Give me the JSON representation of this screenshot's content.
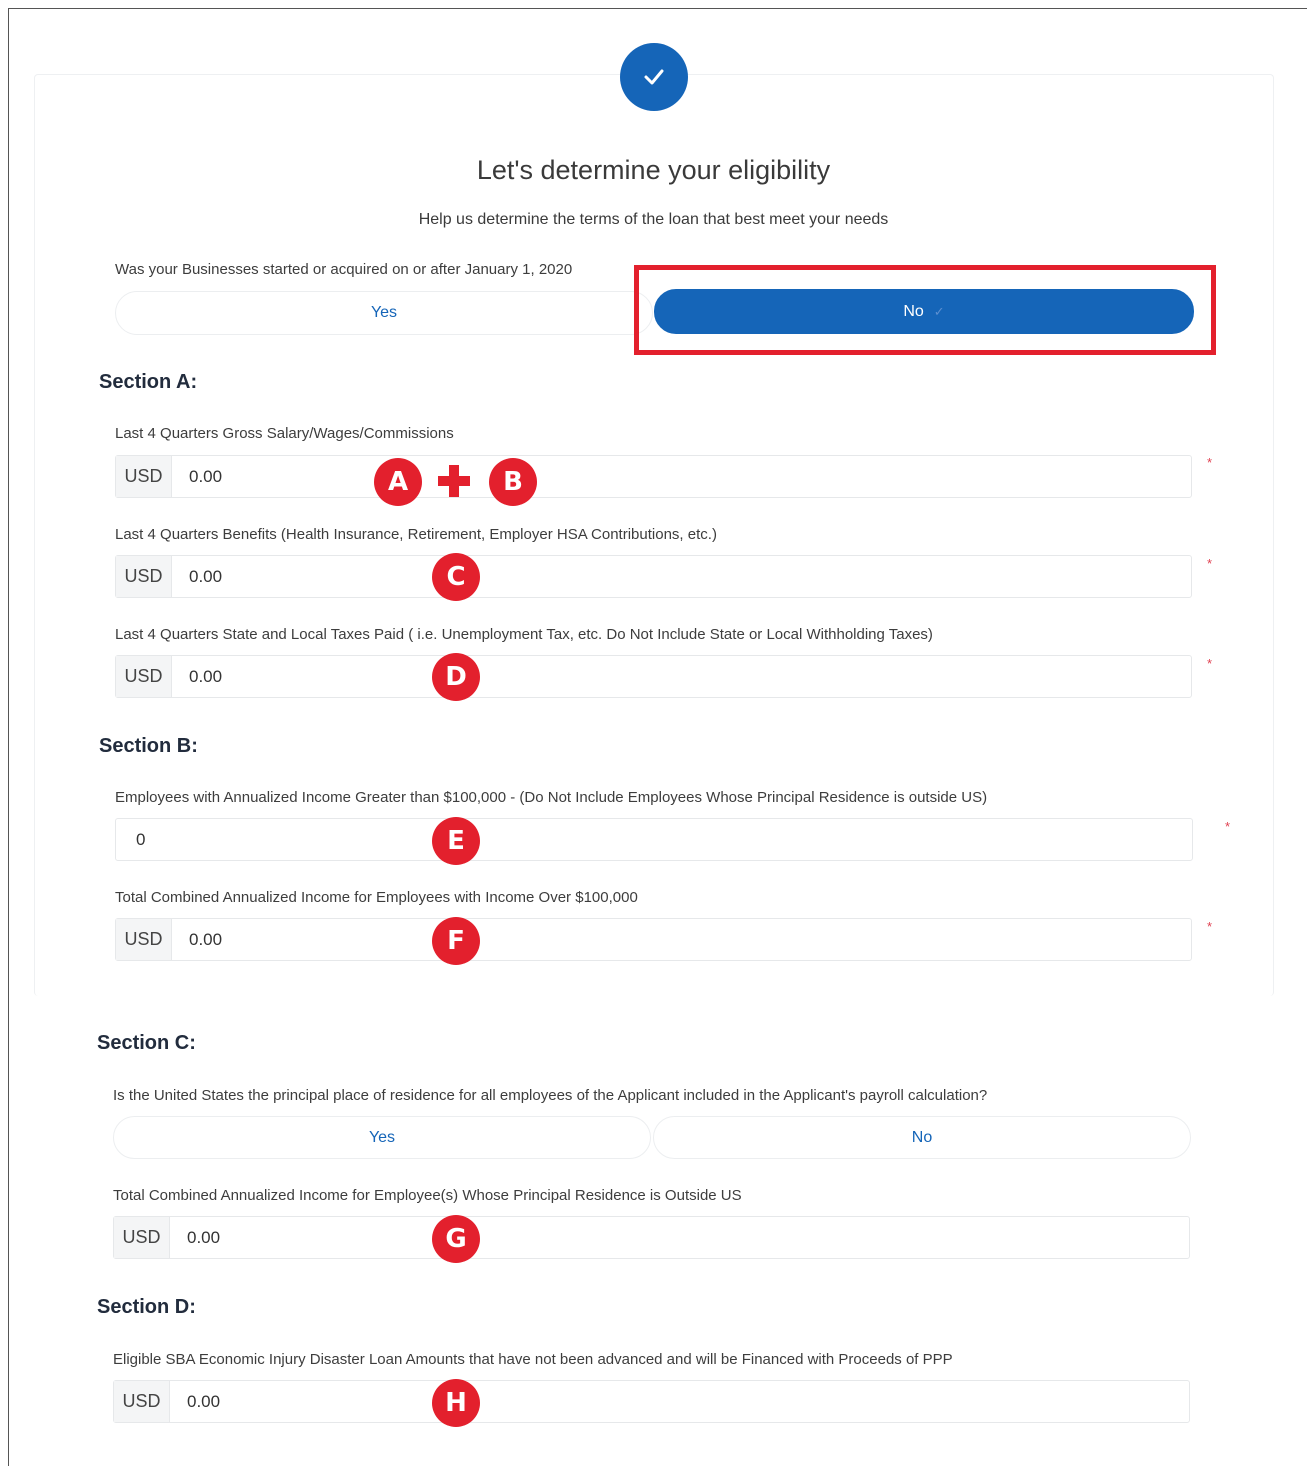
{
  "header": {
    "title": "Let's determine your eligibility",
    "subtitle": "Help us determine the terms of the loan that best meet your needs"
  },
  "question_started": {
    "label": "Was your Businesses started or acquired on or after January 1, 2020",
    "yes_label": "Yes",
    "no_label": "No",
    "selected": "No"
  },
  "section_a": {
    "heading": "Section A:",
    "fields": [
      {
        "label": "Last 4 Quarters Gross Salary/Wages/Commissions",
        "prefix": "USD",
        "value": "0.00",
        "required": "*"
      },
      {
        "label": "Last 4 Quarters Benefits (Health Insurance, Retirement, Employer HSA Contributions, etc.)",
        "prefix": "USD",
        "value": "0.00",
        "required": "*"
      },
      {
        "label": "Last 4 Quarters State and Local Taxes Paid ( i.e. Unemployment Tax, etc. Do Not Include State or Local Withholding Taxes)",
        "prefix": "USD",
        "value": "0.00",
        "required": "*"
      }
    ]
  },
  "section_b": {
    "heading": "Section B:",
    "fields": [
      {
        "label": "Employees with Annualized Income Greater than $100,000 - (Do Not Include Employees Whose Principal Residence is outside US)",
        "value": "0",
        "required": "*"
      },
      {
        "label": "Total Combined Annualized Income for Employees with Income Over $100,000",
        "prefix": "USD",
        "value": "0.00",
        "required": "*"
      }
    ]
  },
  "section_c": {
    "heading": "Section C:",
    "question": "Is the United States the principal place of residence for all employees of the Applicant included in the Applicant's payroll calculation?",
    "yes_label": "Yes",
    "no_label": "No",
    "fields": [
      {
        "label": "Total Combined Annualized Income for Employee(s) Whose Principal Residence is Outside US",
        "prefix": "USD",
        "value": "0.00"
      }
    ]
  },
  "section_d": {
    "heading": "Section D:",
    "fields": [
      {
        "label": "Eligible SBA Economic Injury Disaster Loan Amounts that have not been advanced and will be Financed with Proceeds of PPP",
        "prefix": "USD",
        "value": "0.00"
      }
    ]
  },
  "markers": {
    "a": "A",
    "b": "B",
    "c": "C",
    "d": "D",
    "e": "E",
    "f": "F",
    "g": "G",
    "h": "H"
  },
  "icons": {
    "badge": "check-icon",
    "selected_tick": "check-icon",
    "plus": "plus-icon"
  },
  "colors": {
    "primary": "#1565b8",
    "annotation_red": "#e3202d",
    "required_red": "#e04050"
  }
}
